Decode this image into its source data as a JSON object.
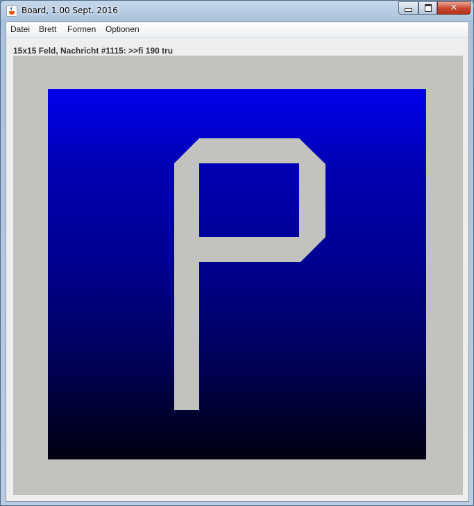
{
  "window": {
    "title": "Board, 1.00 Sept. 2016",
    "icon": "java-cup-icon",
    "controls": {
      "minimize": "minimize-icon",
      "maximize": "maximize-icon",
      "close": "close-icon"
    }
  },
  "menu": {
    "items": [
      {
        "label": "Datei"
      },
      {
        "label": "Brett"
      },
      {
        "label": "Formen"
      },
      {
        "label": "Optionen"
      }
    ]
  },
  "status": {
    "text": "15x15 Feld, Nachricht #1115: >>fi 190 tru"
  },
  "board": {
    "colors": {
      "frame": "#c2c2be",
      "gradient_top": "#0000ee",
      "gradient_bottom": "#000010",
      "shape": "#c2c2be"
    },
    "shape": "P-letter"
  }
}
